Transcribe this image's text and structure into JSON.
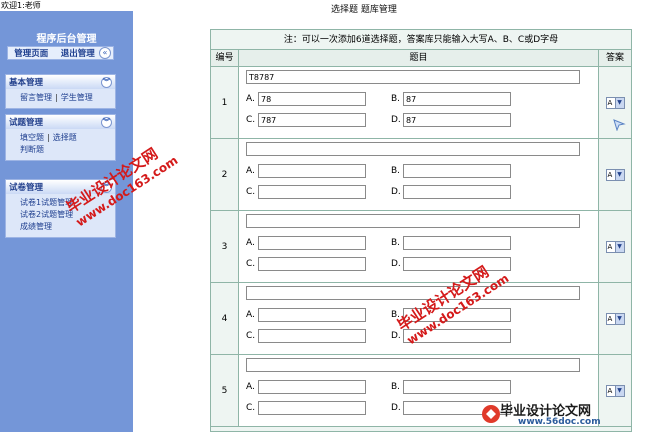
{
  "welcome": "欢迎1:老师",
  "sidebar": {
    "title": "程序后台管理",
    "top_links": [
      "管理页面",
      "退出管理"
    ],
    "groups": [
      {
        "title": "基本管理",
        "items": [
          "留言管理",
          "学生管理"
        ]
      },
      {
        "title": "试题管理",
        "items": [
          "填空题",
          "选择题",
          "判断题"
        ]
      },
      {
        "title": "试卷管理",
        "items": [
          "试卷1试题管理",
          "试卷2试题管理",
          "成绩管理"
        ]
      }
    ]
  },
  "main": {
    "title": "选择题 题库管理",
    "notice": "注：可以一次添加6道选择题，答案库只能输入大写A、B、C或D字母",
    "columns": [
      "编号",
      "题目",
      "答案"
    ],
    "option_labels": [
      "A.",
      "B.",
      "C.",
      "D."
    ],
    "questions": [
      {
        "num": "1",
        "stem": "T8787",
        "a": "78",
        "b": "87",
        "c": "787",
        "d": "87",
        "answer": "A"
      },
      {
        "num": "2",
        "stem": "",
        "a": "",
        "b": "",
        "c": "",
        "d": "",
        "answer": "A"
      },
      {
        "num": "3",
        "stem": "",
        "a": "",
        "b": "",
        "c": "",
        "d": "",
        "answer": "A"
      },
      {
        "num": "4",
        "stem": "",
        "a": "",
        "b": "",
        "c": "",
        "d": "",
        "answer": "A"
      },
      {
        "num": "5",
        "stem": "",
        "a": "",
        "b": "",
        "c": "",
        "d": "",
        "answer": "A"
      }
    ]
  },
  "watermark": {
    "text1": "毕业设计论文网",
    "url1": "www.doc163.com",
    "text2": "毕业设计论文网",
    "url2": "www.doc163.com",
    "logo_text": "毕业设计论文网",
    "logo_url": "www.56doc.com"
  },
  "colors": {
    "sidebar": "#7496d8",
    "panel": "#eef5f2",
    "watermark": "#d41a1a"
  }
}
